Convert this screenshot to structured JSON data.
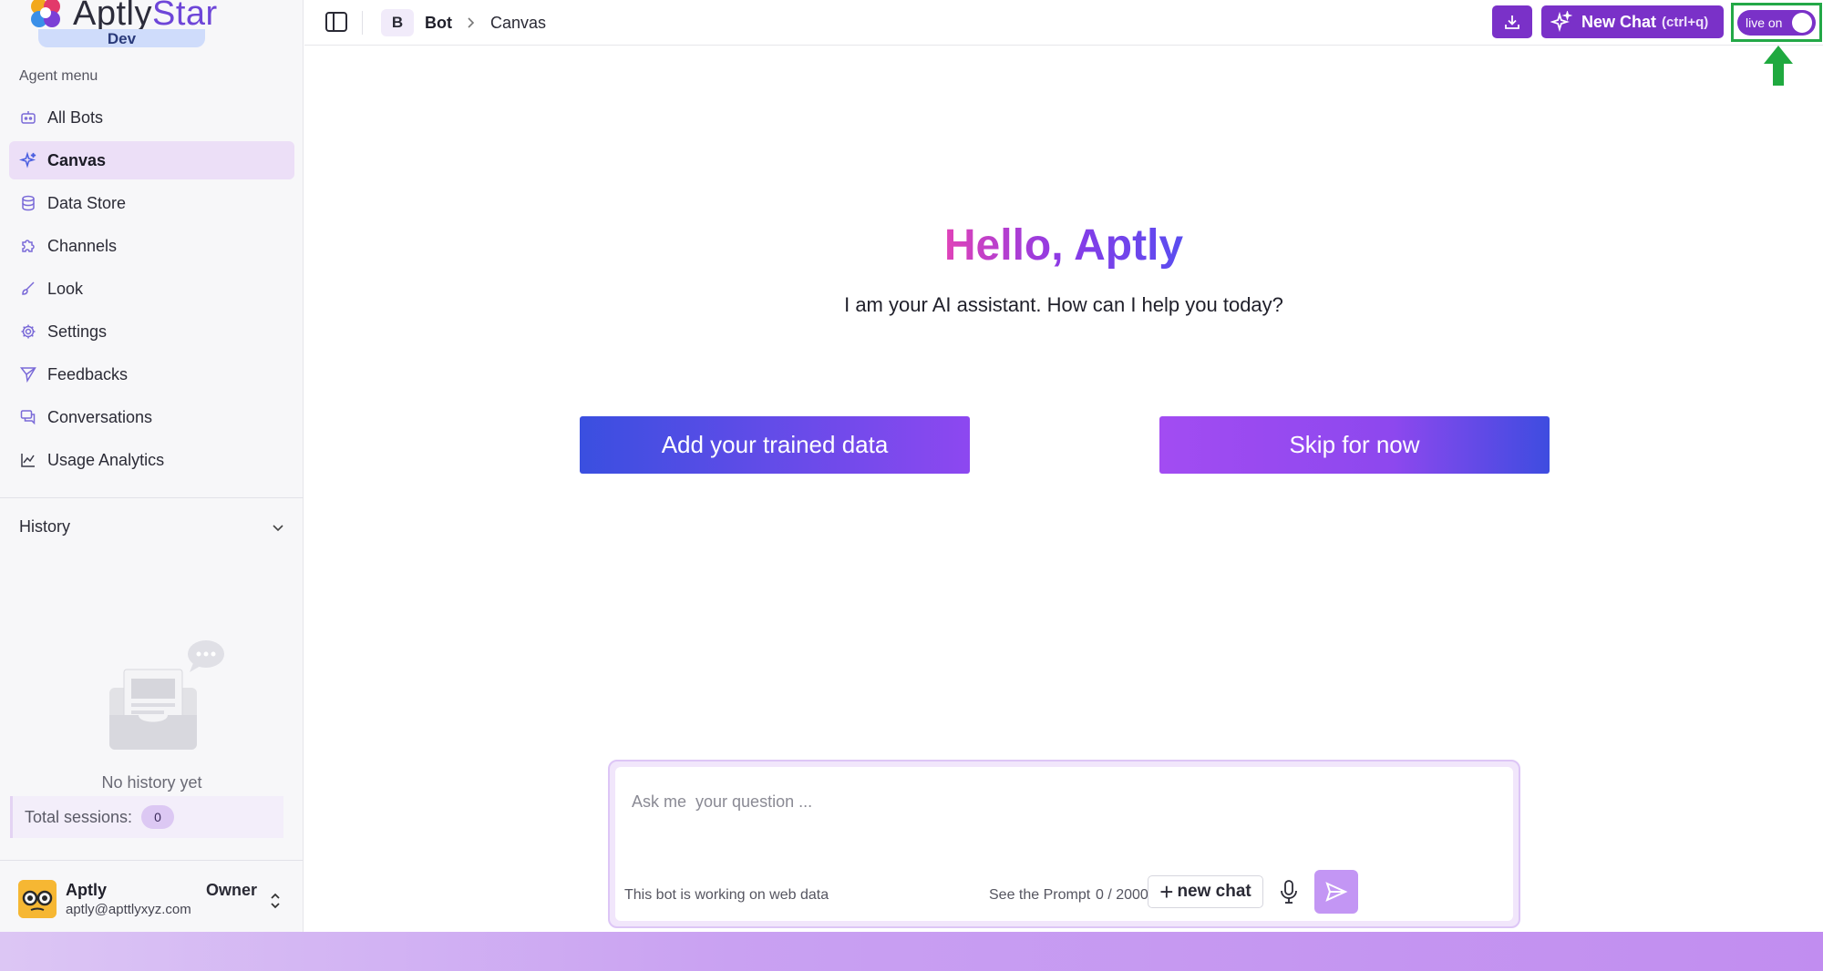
{
  "brand": {
    "name_prefix": "Aptly",
    "name_suffix": "Star",
    "env": "Dev"
  },
  "sidebar": {
    "section_label": "Agent menu",
    "items": [
      {
        "label": "All Bots",
        "icon": "bot-icon"
      },
      {
        "label": "Canvas",
        "icon": "sparkles-icon",
        "active": true
      },
      {
        "label": "Data Store",
        "icon": "database-icon"
      },
      {
        "label": "Channels",
        "icon": "puzzle-icon"
      },
      {
        "label": "Look",
        "icon": "brush-icon"
      },
      {
        "label": "Settings",
        "icon": "gear-icon"
      },
      {
        "label": "Feedbacks",
        "icon": "send-icon"
      },
      {
        "label": "Conversations",
        "icon": "chat-icon"
      },
      {
        "label": "Usage Analytics",
        "icon": "chart-icon"
      }
    ],
    "history": {
      "title": "History",
      "empty_text": "No history yet",
      "sessions_label": "Total sessions:",
      "sessions_count": "0"
    },
    "user": {
      "name": "Aptly",
      "email": "aptly@apttlyxyz.com",
      "role": "Owner"
    }
  },
  "topbar": {
    "breadcrumb_badge": "B",
    "breadcrumb_bot": "Bot",
    "breadcrumb_page": "Canvas",
    "new_chat_label": "New Chat",
    "new_chat_shortcut": "(ctrl+q)",
    "live_label": "live on"
  },
  "main": {
    "greeting": "Hello, Aptly",
    "subtitle": "I am your AI assistant. How can I help you today?",
    "primary_button": "Add your trained data",
    "secondary_button": "Skip for now"
  },
  "composer": {
    "placeholder": "Ask me  your question ...",
    "source_note": "This bot is working on web data",
    "prompt_link": "See the Prompt",
    "char_count": "0 / 2000",
    "new_chat_label": "new chat"
  },
  "colors": {
    "accent": "#7a31c8",
    "active_nav": "#ecdff7",
    "highlight_frame": "#23a847"
  }
}
